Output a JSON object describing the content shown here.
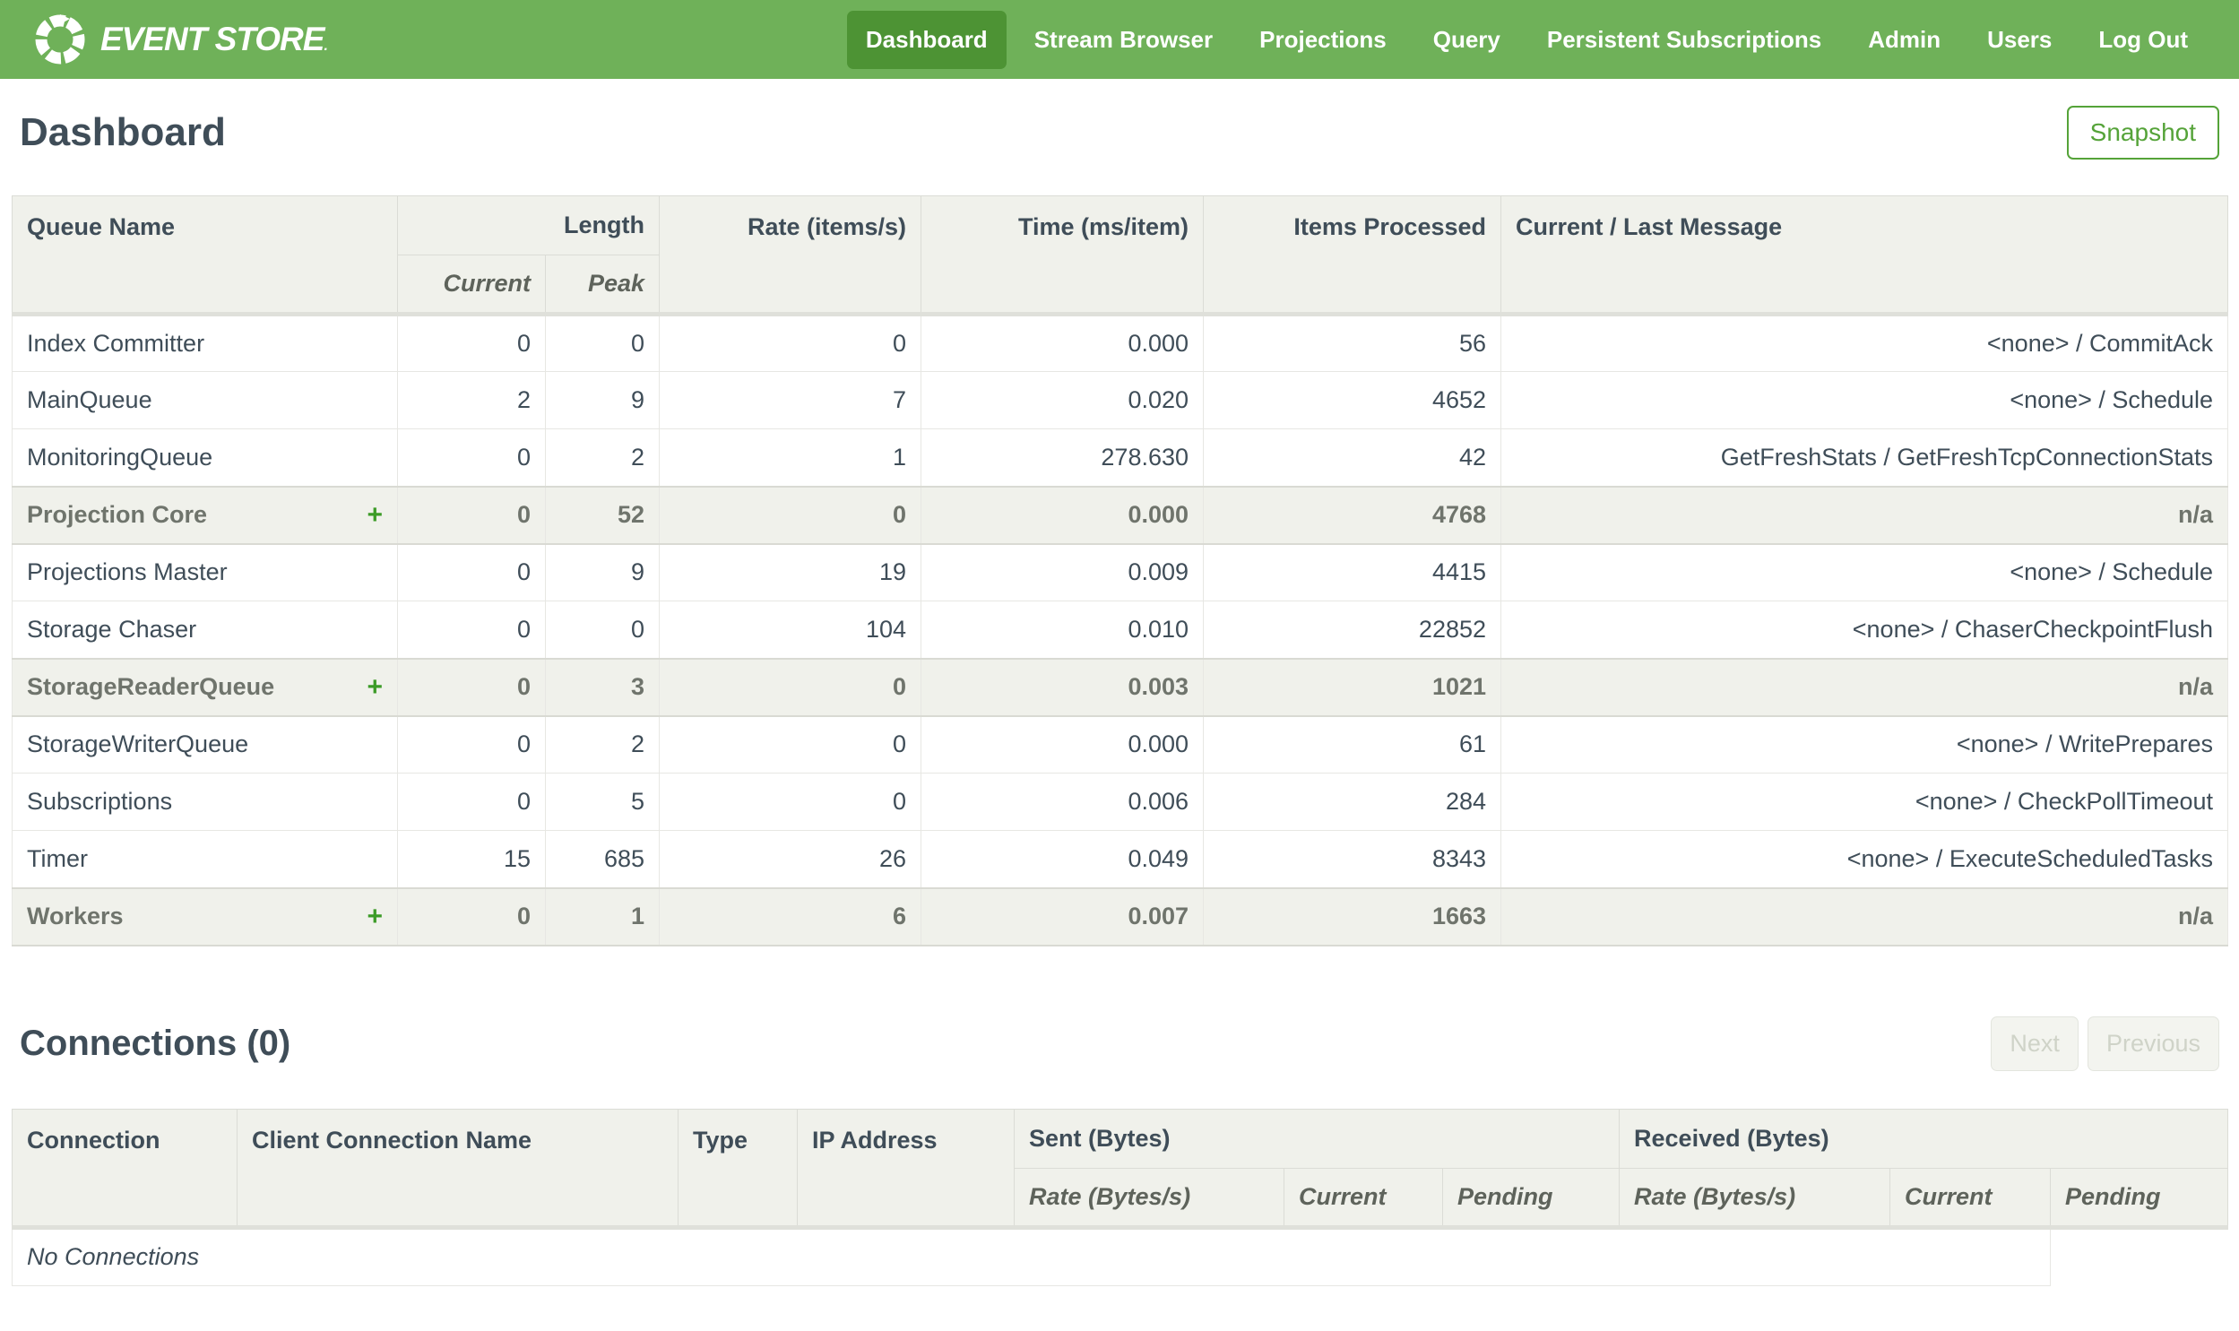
{
  "nav": {
    "brand": "EVENT STORE",
    "brand_mark": ".",
    "items": [
      {
        "label": "Dashboard",
        "active": true
      },
      {
        "label": "Stream Browser"
      },
      {
        "label": "Projections"
      },
      {
        "label": "Query"
      },
      {
        "label": "Persistent Subscriptions"
      },
      {
        "label": "Admin"
      },
      {
        "label": "Users"
      },
      {
        "label": "Log Out"
      }
    ]
  },
  "page": {
    "title": "Dashboard",
    "snapshot_button": "Snapshot"
  },
  "icons": {
    "expand_plus": "+"
  },
  "queues_table": {
    "columns": {
      "queue_name": "Queue Name",
      "length": "Length",
      "length_current": "Current",
      "length_peak": "Peak",
      "rate": "Rate (items/s)",
      "time": "Time (ms/item)",
      "items_processed": "Items Processed",
      "message": "Current / Last Message"
    },
    "rows": [
      {
        "name": "Index Committer",
        "current": "0",
        "peak": "0",
        "rate": "0",
        "time": "0.000",
        "items": "56",
        "message": "<none> / CommitAck"
      },
      {
        "name": "MainQueue",
        "current": "2",
        "peak": "9",
        "rate": "7",
        "time": "0.020",
        "items": "4652",
        "message": "<none> / Schedule"
      },
      {
        "name": "MonitoringQueue",
        "current": "0",
        "peak": "2",
        "rate": "1",
        "time": "278.630",
        "items": "42",
        "message": "GetFreshStats / GetFreshTcpConnectionStats"
      },
      {
        "name": "Projection Core",
        "group": true,
        "current": "0",
        "peak": "52",
        "rate": "0",
        "time": "0.000",
        "items": "4768",
        "message": "n/a"
      },
      {
        "name": "Projections Master",
        "current": "0",
        "peak": "9",
        "rate": "19",
        "time": "0.009",
        "items": "4415",
        "message": "<none> / Schedule"
      },
      {
        "name": "Storage Chaser",
        "current": "0",
        "peak": "0",
        "rate": "104",
        "time": "0.010",
        "items": "22852",
        "message": "<none> / ChaserCheckpointFlush"
      },
      {
        "name": "StorageReaderQueue",
        "group": true,
        "current": "0",
        "peak": "3",
        "rate": "0",
        "time": "0.003",
        "items": "1021",
        "message": "n/a"
      },
      {
        "name": "StorageWriterQueue",
        "current": "0",
        "peak": "2",
        "rate": "0",
        "time": "0.000",
        "items": "61",
        "message": "<none> / WritePrepares"
      },
      {
        "name": "Subscriptions",
        "current": "0",
        "peak": "5",
        "rate": "0",
        "time": "0.006",
        "items": "284",
        "message": "<none> / CheckPollTimeout"
      },
      {
        "name": "Timer",
        "current": "15",
        "peak": "685",
        "rate": "26",
        "time": "0.049",
        "items": "8343",
        "message": "<none> / ExecuteScheduledTasks"
      },
      {
        "name": "Workers",
        "group": true,
        "current": "0",
        "peak": "1",
        "rate": "6",
        "time": "0.007",
        "items": "1663",
        "message": "n/a"
      }
    ]
  },
  "connections": {
    "title": "Connections (0)",
    "next_button": "Next",
    "previous_button": "Previous",
    "columns": {
      "connection": "Connection",
      "client_connection_name": "Client Connection Name",
      "type": "Type",
      "ip_address": "IP Address",
      "sent": "Sent (Bytes)",
      "received": "Received (Bytes)",
      "rate": "Rate (Bytes/s)",
      "current": "Current",
      "pending": "Pending"
    },
    "empty_message": "No Connections"
  },
  "colors": {
    "nav_green": "#6fb159",
    "nav_active_green": "#4d9334",
    "accent_green": "#55a339",
    "plus_green": "#3c9b27",
    "text_slate": "#3f4d58",
    "group_text_gray": "#6f746c",
    "header_bg": "#f0f1eb",
    "border_gray": "#e7e7e3",
    "disabled_text": "#cfd3c8"
  }
}
